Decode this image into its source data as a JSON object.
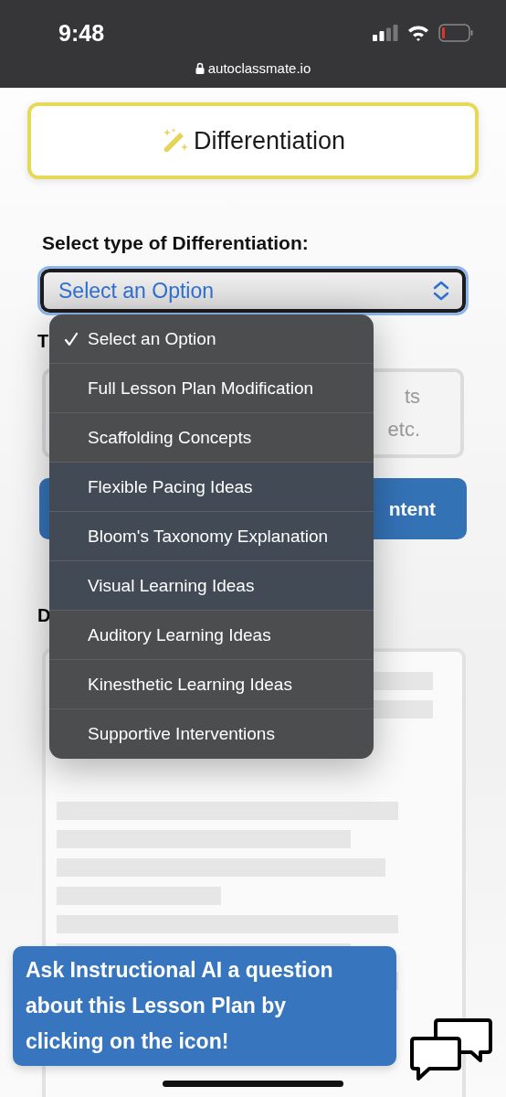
{
  "status_bar": {
    "time": "9:48",
    "url": "autoclassmate.io"
  },
  "header": {
    "title": "Differentiation"
  },
  "type_field": {
    "label": "Select type of Differentiation:",
    "value": "Select an Option"
  },
  "menu": [
    {
      "label": "Select an Option",
      "selected": true
    },
    {
      "label": "Full Lesson Plan Modification",
      "selected": false
    },
    {
      "label": "Scaffolding Concepts",
      "selected": false
    },
    {
      "label": "Flexible Pacing Ideas",
      "selected": false
    },
    {
      "label": "Bloom's Taxonomy Explanation",
      "selected": false
    },
    {
      "label": "Visual Learning Ideas",
      "selected": false
    },
    {
      "label": "Auditory Learning Ideas",
      "selected": false
    },
    {
      "label": "Kinesthetic Learning Ideas",
      "selected": false
    },
    {
      "label": "Supportive Interventions",
      "selected": false
    }
  ],
  "text_label": "T",
  "text_area": {
    "lines": [
      "ts",
      "etc."
    ]
  },
  "generate_button": "ntent",
  "output_label": "D",
  "tooltip": "Ask Instructional AI a question about this Lesson Plan by clicking on the icon!"
}
